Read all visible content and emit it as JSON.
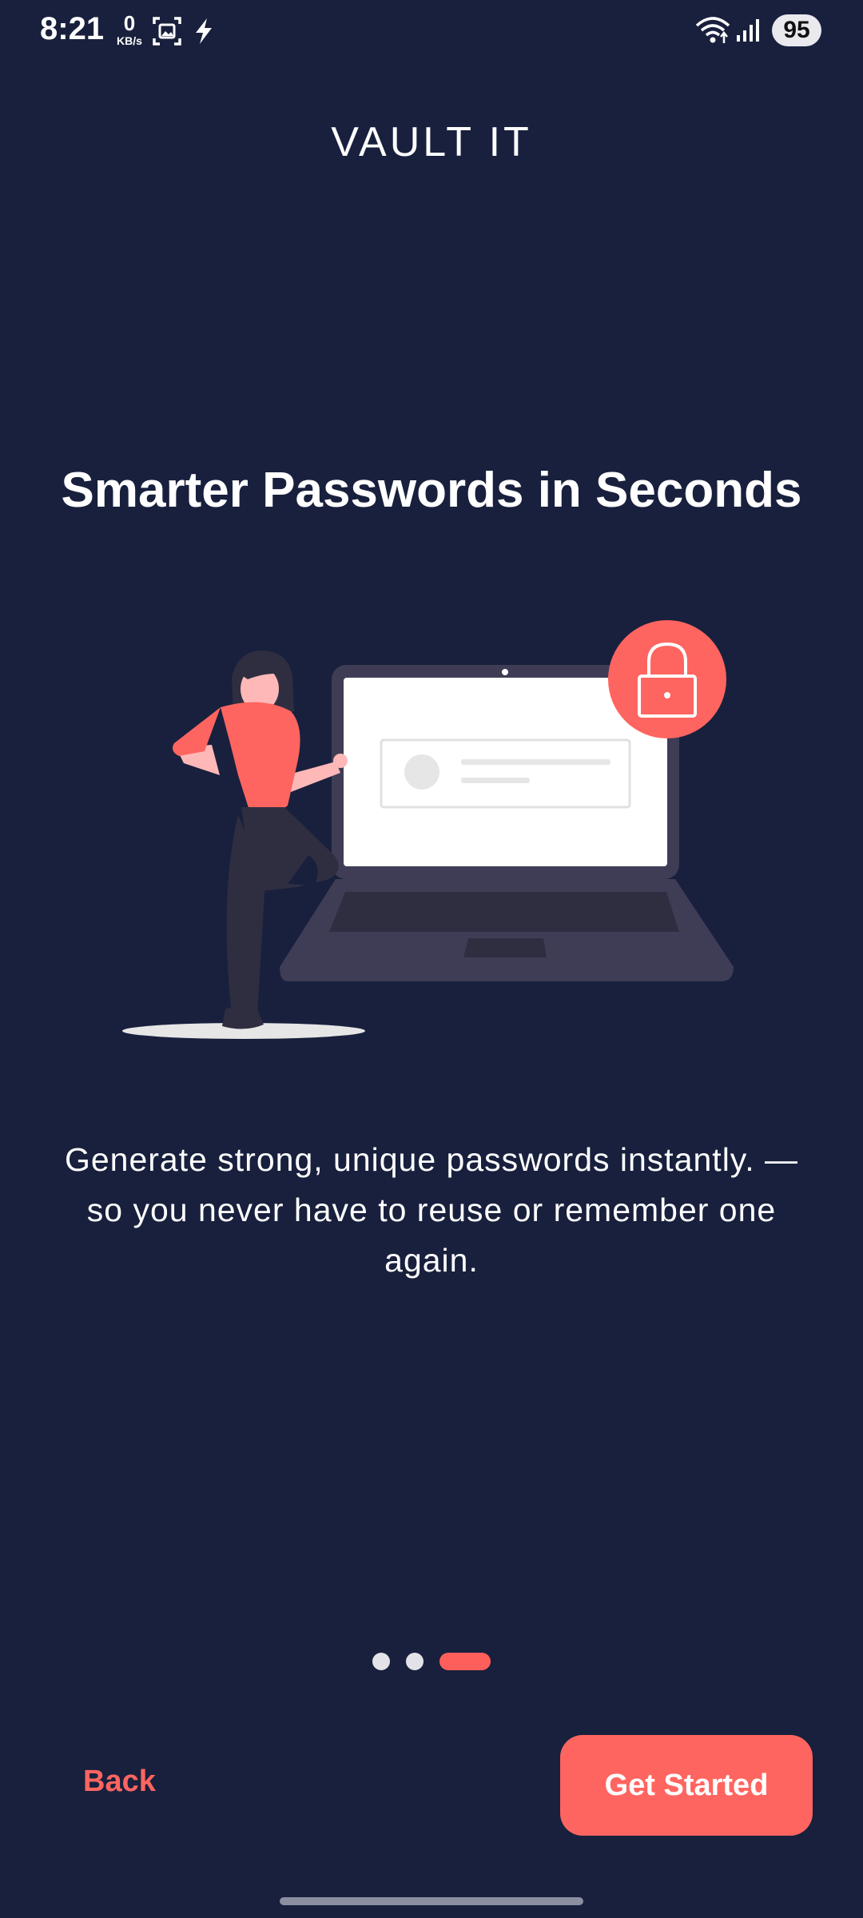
{
  "status_bar": {
    "time": "8:21",
    "net_speed_value": "0",
    "net_speed_unit": "KB/s",
    "battery": "95",
    "icons": [
      "screenshot-icon",
      "flash-icon",
      "wifi-icon",
      "signal-icon"
    ]
  },
  "header": {
    "app_name": "VAULT IT"
  },
  "onboarding": {
    "headline": "Smarter Passwords in Seconds",
    "description": "Generate strong, unique passwords instantly. — so you never have to reuse or remember one again.",
    "page_index": 3,
    "page_count": 3
  },
  "actions": {
    "back_label": "Back",
    "primary_label": "Get Started"
  },
  "colors": {
    "background": "#18203d",
    "accent": "#ff6560",
    "text": "#ffffff"
  }
}
